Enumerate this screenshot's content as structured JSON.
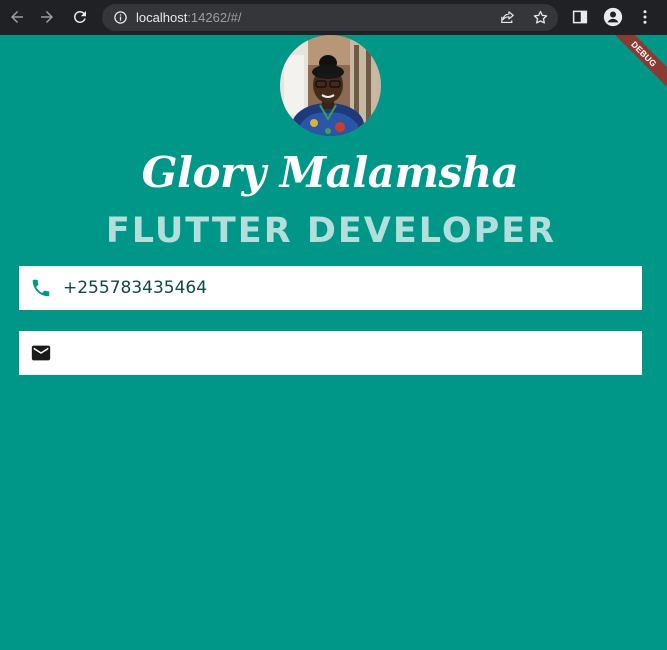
{
  "browser": {
    "url_host": "localhost",
    "url_rest": ":14262/#/",
    "icons": [
      "back-arrow-icon",
      "forward-arrow-icon",
      "reload-icon",
      "info-icon",
      "share-icon",
      "star-icon",
      "side-panel-icon",
      "profile-icon",
      "menu-icon"
    ]
  },
  "debug_banner": "DEBUG",
  "profile": {
    "name": "Glory Malamsha",
    "title": "FLUTTER DEVELOPER"
  },
  "contacts": {
    "phone": "+255783435464",
    "email": ""
  },
  "colors": {
    "background": "#009688",
    "title_text": "#b2dfdb",
    "card": "#ffffff",
    "phone_icon": "#009688",
    "ribbon": "#8b3a32"
  }
}
